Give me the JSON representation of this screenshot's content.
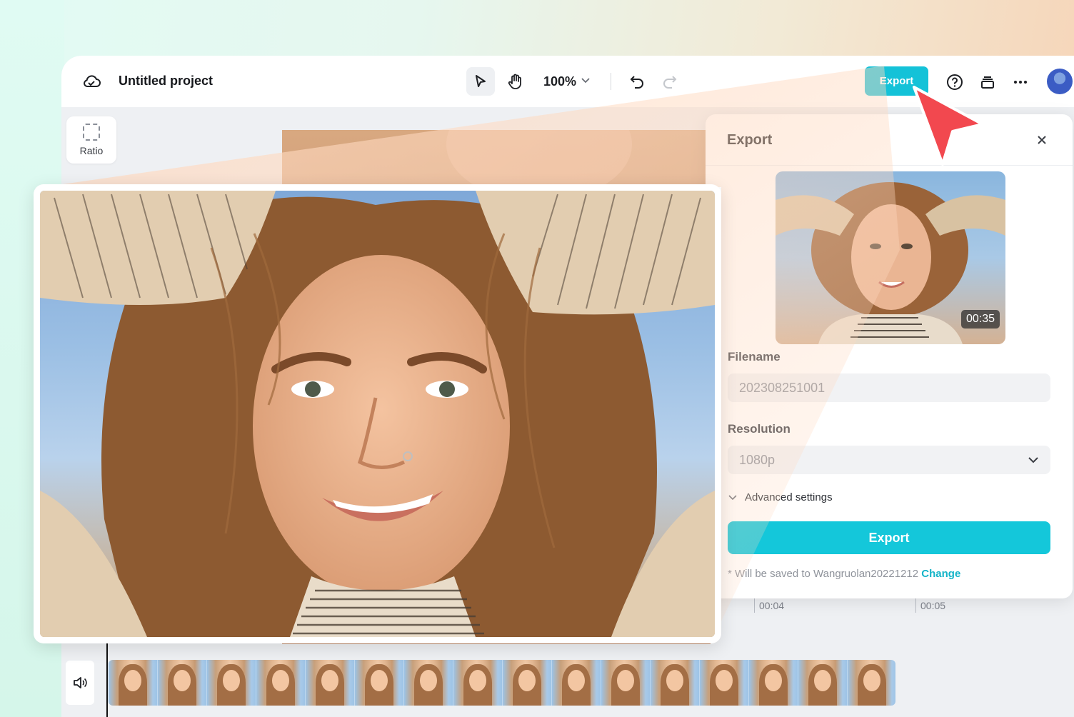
{
  "app": {
    "project_title": "Untitled project",
    "zoom": "100%",
    "export_button": "Export"
  },
  "sidebar": {
    "ratio_label": "Ratio"
  },
  "timeline": {
    "marks": [
      "00:04",
      "00:05"
    ]
  },
  "export_panel": {
    "title": "Export",
    "thumbnail_duration": "00:35",
    "filename_label": "Filename",
    "filename_value": "202308251001",
    "resolution_label": "Resolution",
    "resolution_value": "1080p",
    "advanced_label": "Advanced settings",
    "export_button": "Export",
    "save_note_prefix": "* Will be saved to Wangruolan20221212",
    "save_note_change": "Change"
  },
  "colors": {
    "accent": "#14c2d8",
    "pointer": "#f2484f"
  },
  "icons": {
    "cloud": "cloud-icon",
    "select": "cursor-arrow-icon",
    "hand": "hand-icon",
    "undo": "undo-icon",
    "redo": "redo-icon",
    "help": "help-icon",
    "layers": "layers-icon",
    "more": "more-icon",
    "close": "close-icon",
    "volume": "volume-icon"
  }
}
